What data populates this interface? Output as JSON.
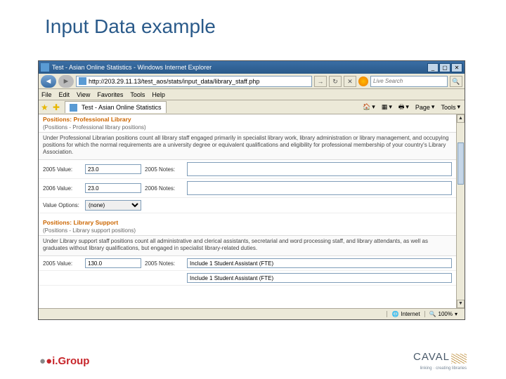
{
  "slide": {
    "title": "Input Data example"
  },
  "browser": {
    "title": "Test - Asian Online Statistics - Windows Internet Explorer",
    "url": "http://203.29.11.13/test_aos/stats/input_data/library_staff.php",
    "search_placeholder": "Live Search",
    "menu": {
      "file": "File",
      "edit": "Edit",
      "view": "View",
      "favorites": "Favorites",
      "tools": "Tools",
      "help": "Help"
    },
    "tab_label": "Test - Asian Online Statistics",
    "tool_home": "Home",
    "tool_feeds": "Feeds",
    "tool_print": "Print",
    "tool_page": "Page",
    "tool_tools": "Tools",
    "status_zone": "Internet",
    "status_zoom": "100%"
  },
  "form": {
    "sec1": {
      "heading": "Positions: Professional Library",
      "subheading": "(Positions - Professional library positions)",
      "desc": "Under Professional Librarian positions count all library staff engaged primarily in specialist library work, library administration or library management, and occupying positions for which the normal requirements are a university degree or equivalent qualifications and eligibility for professional membership of your country's Library Association.",
      "r1_label": "2005 Value:",
      "r1_value": "23.0",
      "r1_notes_label": "2005 Notes:",
      "r1_notes": "",
      "r2_label": "2006 Value:",
      "r2_value": "23.0",
      "r2_notes_label": "2006 Notes:",
      "r2_notes": "",
      "unit_label": "Value Options:",
      "unit_value": "(none)"
    },
    "sec2": {
      "heading": "Positions: Library Support",
      "subheading": "(Positions - Library support positions)",
      "desc": "Under Library support staff positions count all administrative and clerical assistants, secretarial and word processing staff, and library attendants, as well as graduates without library qualifications, but engaged in specialist library-related duties.",
      "r1_label": "2005 Value:",
      "r1_value": "130.0",
      "r1_notes_label": "2005 Notes:",
      "r1_notes": "Include 1 Student Assistant (FTE)",
      "r2_notes": "Include 1 Student Assistant (FTE)"
    }
  },
  "footer": {
    "igroup": "i.Group",
    "caval": "CAVAL",
    "caval_sub": "linking · creating libraries"
  }
}
